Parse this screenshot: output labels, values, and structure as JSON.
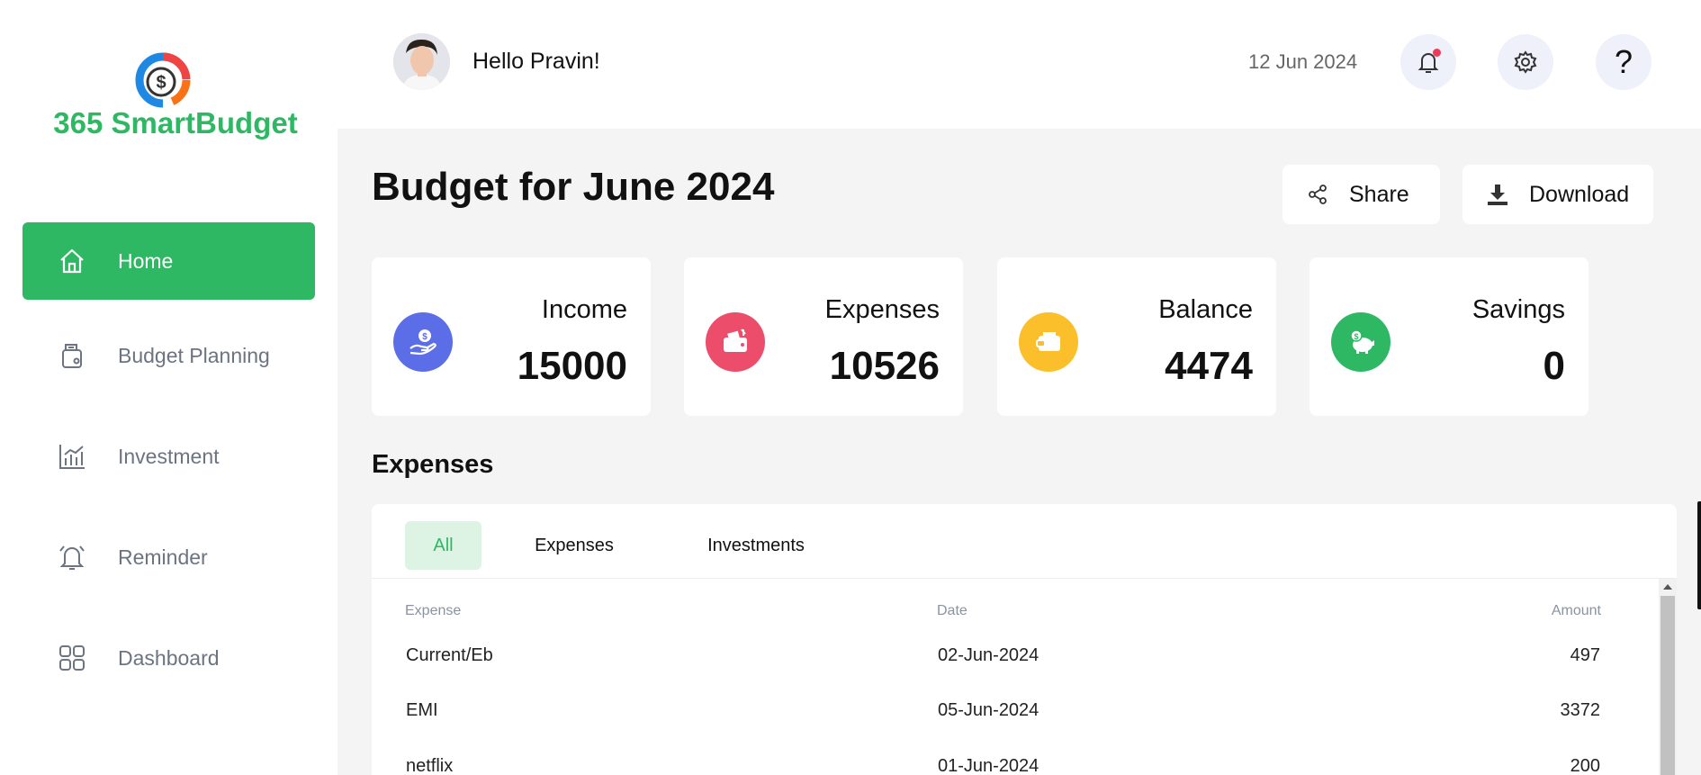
{
  "brand": {
    "name": "365 SmartBudget"
  },
  "sidebar": {
    "items": [
      {
        "label": "Home",
        "icon": "home-icon",
        "active": true
      },
      {
        "label": "Budget Planning",
        "icon": "wallet-icon",
        "active": false
      },
      {
        "label": "Investment",
        "icon": "chart-icon",
        "active": false
      },
      {
        "label": "Reminder",
        "icon": "alarm-icon",
        "active": false
      },
      {
        "label": "Dashboard",
        "icon": "grid-icon",
        "active": false
      }
    ]
  },
  "header": {
    "greeting": "Hello Pravin!",
    "date": "12 Jun 2024",
    "help_label": "?"
  },
  "page": {
    "title": "Budget for June 2024",
    "share_label": "Share",
    "download_label": "Download"
  },
  "stats": [
    {
      "label": "Income",
      "value": "15000",
      "icon": "income-icon",
      "color": "#5b6ee8"
    },
    {
      "label": "Expenses",
      "value": "10526",
      "icon": "wallet-icon",
      "color": "#ec4d6b"
    },
    {
      "label": "Balance",
      "value": "4474",
      "icon": "balance-icon",
      "color": "#fbbf2c"
    },
    {
      "label": "Savings",
      "value": "0",
      "icon": "piggy-bank-icon",
      "color": "#2fb863"
    }
  ],
  "expenses": {
    "section_title": "Expenses",
    "tabs": [
      {
        "label": "All",
        "active": true
      },
      {
        "label": "Expenses",
        "active": false
      },
      {
        "label": "Investments",
        "active": false
      }
    ],
    "columns": {
      "expense": "Expense",
      "date": "Date",
      "amount": "Amount"
    },
    "rows": [
      {
        "expense": "Current/Eb",
        "date": "02-Jun-2024",
        "amount": "497"
      },
      {
        "expense": "EMI",
        "date": "05-Jun-2024",
        "amount": "3372"
      },
      {
        "expense": "netflix",
        "date": "01-Jun-2024",
        "amount": "200"
      }
    ]
  },
  "colors": {
    "accent": "#2fb863",
    "background": "#f4f4f4"
  }
}
